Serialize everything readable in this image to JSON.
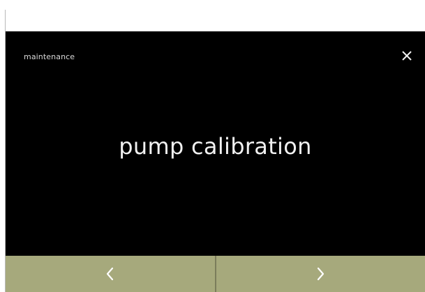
{
  "window": {
    "menu_title": "maintenance",
    "feature_label": "pump calibration"
  },
  "icons": {
    "close": "close-icon",
    "previous": "chevron-left-icon",
    "next": "chevron-right-icon"
  },
  "colors": {
    "screen_background": "#000000",
    "nav_bar": "#a6a97c",
    "nav_divider": "#7b7d5b",
    "text": "#f1f1f1"
  }
}
